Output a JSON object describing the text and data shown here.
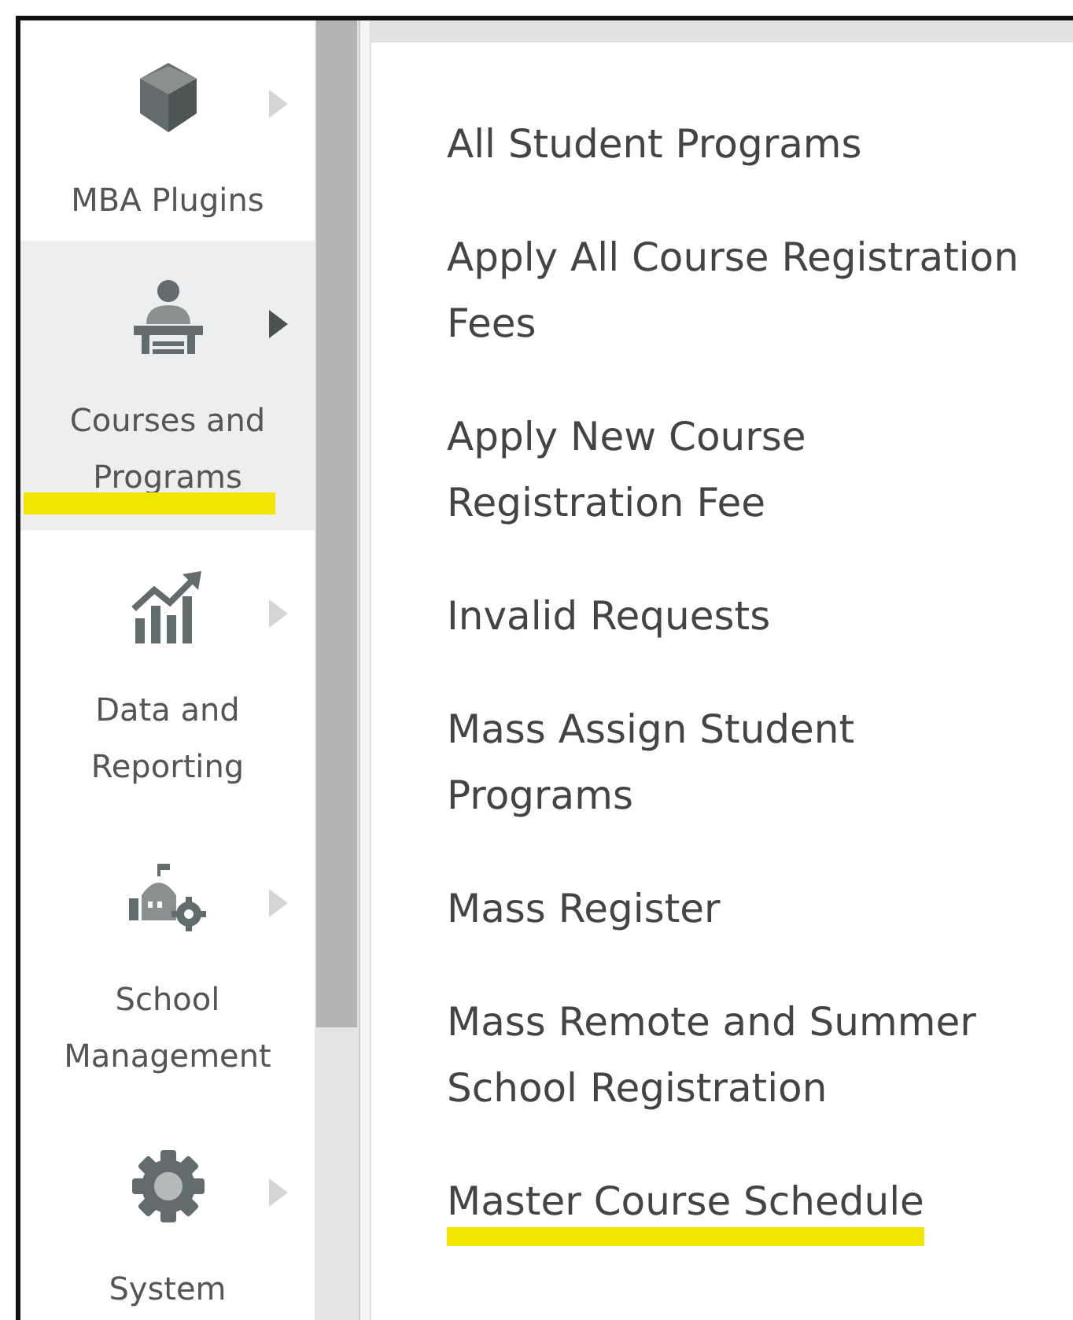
{
  "sidebar": {
    "items": [
      {
        "label": "MBA Plugins",
        "kind": "cube",
        "selected": false,
        "underlined": false
      },
      {
        "label": "Courses and Programs",
        "kind": "presenter",
        "selected": true,
        "underlined": true
      },
      {
        "label": "Data and Reporting",
        "kind": "chart",
        "selected": false,
        "underlined": false
      },
      {
        "label": "School Management",
        "kind": "school",
        "selected": false,
        "underlined": false
      },
      {
        "label": "System",
        "kind": "gear",
        "selected": false,
        "underlined": false
      }
    ]
  },
  "submenu": {
    "items": [
      {
        "label": "All Student Programs",
        "underlined": false
      },
      {
        "label": "Apply All Course Registration Fees",
        "underlined": false
      },
      {
        "label": "Apply New Course Registration Fee",
        "underlined": false
      },
      {
        "label": "Invalid Requests",
        "underlined": false
      },
      {
        "label": "Mass Assign Student Programs",
        "underlined": false
      },
      {
        "label": "Mass Register",
        "underlined": false
      },
      {
        "label": "Mass Remote and Summer School Registration",
        "underlined": false
      },
      {
        "label": "Master Course Schedule",
        "underlined": true
      }
    ]
  }
}
